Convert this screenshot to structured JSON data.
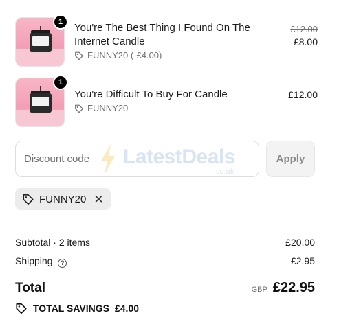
{
  "items": [
    {
      "quantity": "1",
      "title": "You're The Best Thing I Found On The Internet Candle",
      "discount_text": "FUNNY20 (-£4.00)",
      "original_price": "£12.00",
      "price": "£8.00"
    },
    {
      "quantity": "1",
      "title": "You're Difficult To Buy For Candle",
      "discount_text": "FUNNY20",
      "price": "£12.00"
    }
  ],
  "discount": {
    "placeholder": "Discount code",
    "apply_label": "Apply",
    "applied_code": "FUNNY20"
  },
  "watermark": {
    "brand": "LatestDeals",
    "domain": ".co.uk"
  },
  "summary": {
    "subtotal_label": "Subtotal · 2 items",
    "subtotal_value": "£20.00",
    "shipping_label": "Shipping",
    "shipping_value": "£2.95",
    "total_label": "Total",
    "currency": "GBP",
    "total_value": "£22.95",
    "savings_label": "TOTAL SAVINGS",
    "savings_value": "£4.00"
  },
  "icons": {
    "discount_tag": "tag-icon",
    "remove": "close-icon",
    "shipping_help": "help-icon",
    "savings": "tag-icon"
  },
  "colors": {
    "badge": "#000000",
    "chip_bg": "#ececec",
    "apply_bg": "#f3f3f3",
    "muted_text": "#707070"
  }
}
